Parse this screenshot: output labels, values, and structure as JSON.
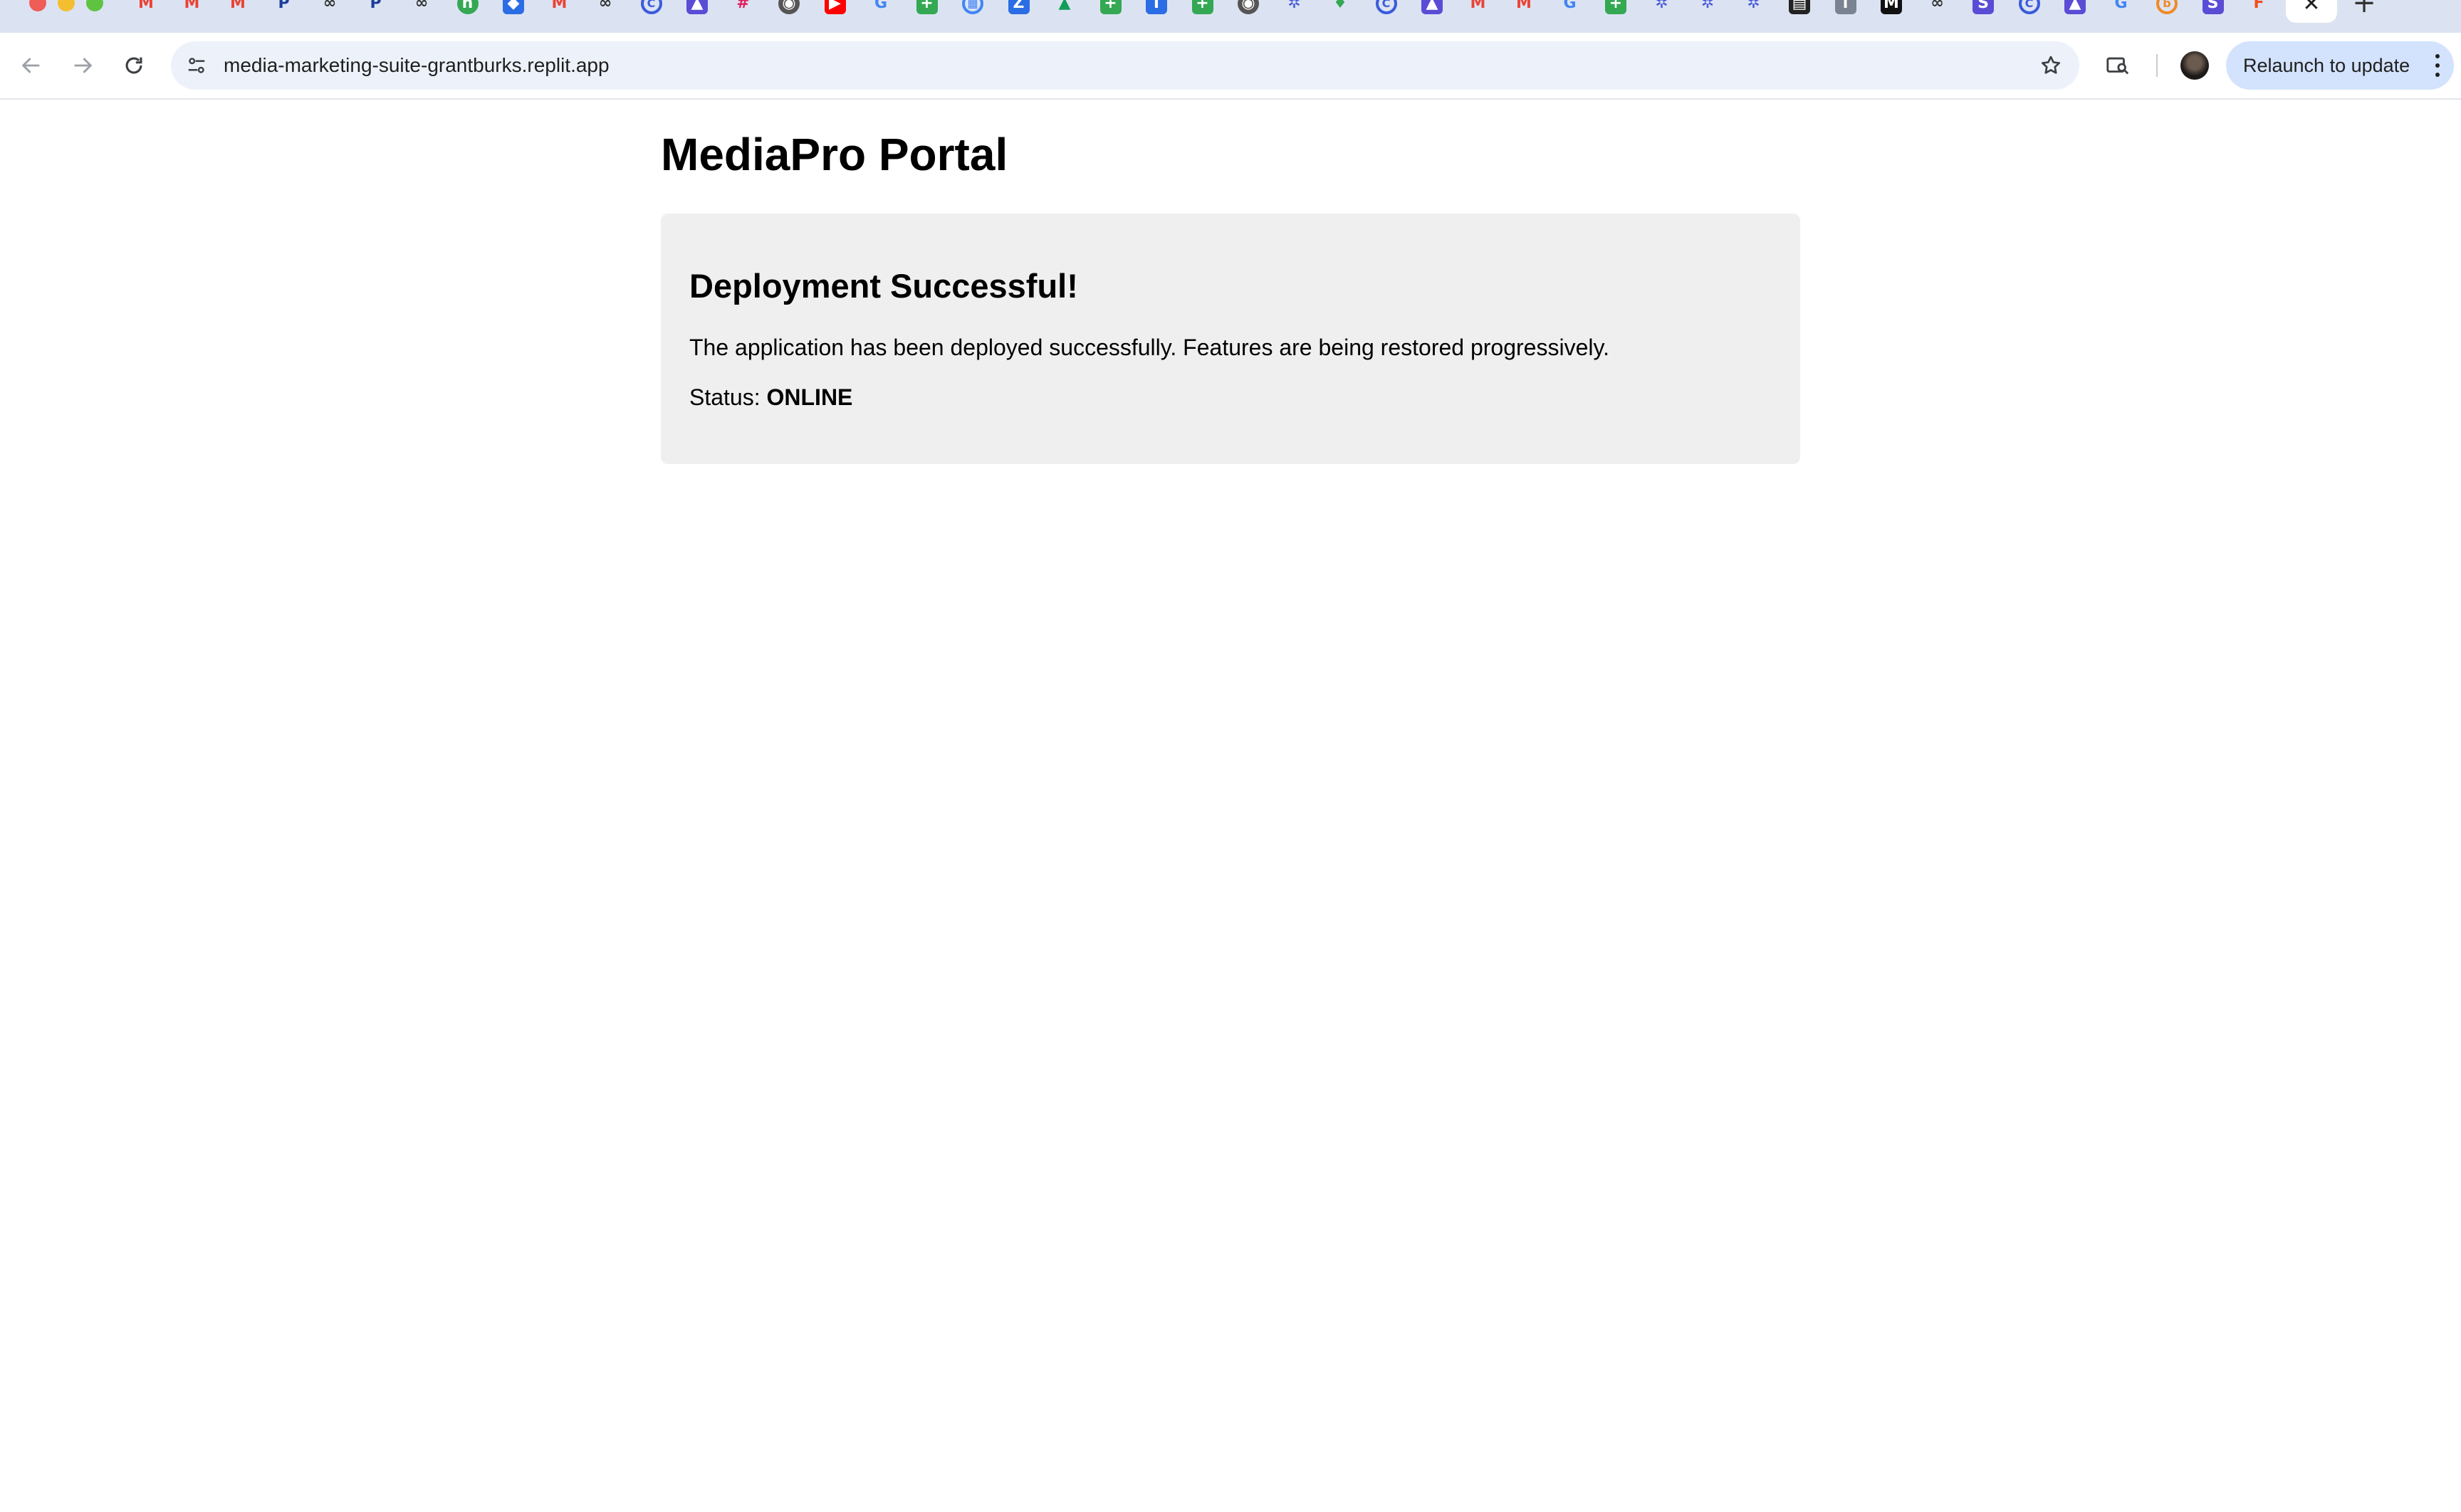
{
  "browser": {
    "url": "media-marketing-suite-grantburks.replit.app",
    "relaunch_label": "Relaunch to update",
    "tabs": [
      {
        "icon": "gmail-icon",
        "glyph": "M",
        "color": "#ea4335",
        "style": "plain"
      },
      {
        "icon": "gmail-icon",
        "glyph": "M",
        "color": "#ea4335",
        "style": "plain"
      },
      {
        "icon": "gmail-icon",
        "glyph": "M",
        "color": "#ea4335",
        "style": "plain"
      },
      {
        "icon": "paypal-icon",
        "glyph": "P",
        "color": "#1a3e9a",
        "style": "plain"
      },
      {
        "icon": "link-icon",
        "glyph": "∞",
        "color": "#333333",
        "style": "plain"
      },
      {
        "icon": "paypal-icon",
        "glyph": "P",
        "color": "#1a3e9a",
        "style": "plain"
      },
      {
        "icon": "link-icon",
        "glyph": "∞",
        "color": "#333333",
        "style": "plain"
      },
      {
        "icon": "green-app-icon",
        "glyph": "h",
        "color": "#34a853",
        "style": "circle"
      },
      {
        "icon": "dropbox-icon",
        "glyph": "◆",
        "color": "#2b6de4",
        "style": "square"
      },
      {
        "icon": "gmail-icon",
        "glyph": "M",
        "color": "#ea4335",
        "style": "plain"
      },
      {
        "icon": "link-icon",
        "glyph": "∞",
        "color": "#333333",
        "style": "plain"
      },
      {
        "icon": "blue-circle-icon",
        "glyph": "C",
        "color": "#3b5bdb",
        "style": "outline"
      },
      {
        "icon": "photo-icon",
        "glyph": "▲",
        "color": "#5b4cd6",
        "style": "square"
      },
      {
        "icon": "slack-icon",
        "glyph": "#",
        "color": "#e01e5a",
        "style": "plain"
      },
      {
        "icon": "globe-icon",
        "glyph": "◉",
        "color": "#555555",
        "style": "circle"
      },
      {
        "icon": "youtube-icon",
        "glyph": "▶",
        "color": "#ff0000",
        "style": "square"
      },
      {
        "icon": "google-icon",
        "glyph": "G",
        "color": "#4285f4",
        "style": "plain"
      },
      {
        "icon": "sheets-icon",
        "glyph": "+",
        "color": "#34a853",
        "style": "square"
      },
      {
        "icon": "calendar-icon",
        "glyph": "▦",
        "color": "#4285f4",
        "style": "outline"
      },
      {
        "icon": "blue-doc-icon",
        "glyph": "Z",
        "color": "#2b6de4",
        "style": "square"
      },
      {
        "icon": "drive-icon",
        "glyph": "▲",
        "color": "#0f9d58",
        "style": "plain"
      },
      {
        "icon": "sheets-icon",
        "glyph": "+",
        "color": "#34a853",
        "style": "square"
      },
      {
        "icon": "blue-doc-icon",
        "glyph": "I",
        "color": "#2b6de4",
        "style": "square"
      },
      {
        "icon": "sheets-icon",
        "glyph": "+",
        "color": "#34a853",
        "style": "square"
      },
      {
        "icon": "globe-icon",
        "glyph": "◉",
        "color": "#555555",
        "style": "circle"
      },
      {
        "icon": "gear-icon",
        "glyph": "✲",
        "color": "#4a5bd8",
        "style": "plain"
      },
      {
        "icon": "maps-icon",
        "glyph": "♦",
        "color": "#34a853",
        "style": "plain"
      },
      {
        "icon": "blue-circle-icon",
        "glyph": "C",
        "color": "#3b5bdb",
        "style": "outline"
      },
      {
        "icon": "photo-icon",
        "glyph": "▲",
        "color": "#5b4cd6",
        "style": "square"
      },
      {
        "icon": "gmail-icon",
        "glyph": "M",
        "color": "#ea4335",
        "style": "plain"
      },
      {
        "icon": "gmail-icon",
        "glyph": "M",
        "color": "#ea4335",
        "style": "plain"
      },
      {
        "icon": "google-icon",
        "glyph": "G",
        "color": "#4285f4",
        "style": "plain"
      },
      {
        "icon": "sheets-icon",
        "glyph": "+",
        "color": "#34a853",
        "style": "square"
      },
      {
        "icon": "gear-icon",
        "glyph": "✲",
        "color": "#4a5bd8",
        "style": "plain"
      },
      {
        "icon": "gear-icon",
        "glyph": "✲",
        "color": "#4a5bd8",
        "style": "plain"
      },
      {
        "icon": "gear-icon",
        "glyph": "✲",
        "color": "#4a5bd8",
        "style": "plain"
      },
      {
        "icon": "dark-app-icon",
        "glyph": "▤",
        "color": "#222222",
        "style": "square"
      },
      {
        "icon": "grey-doc-icon",
        "glyph": "i",
        "color": "#7a8391",
        "style": "square"
      },
      {
        "icon": "medium-icon",
        "glyph": "M",
        "color": "#111111",
        "style": "square"
      },
      {
        "icon": "link-icon",
        "glyph": "∞",
        "color": "#333333",
        "style": "plain"
      },
      {
        "icon": "purple-app-icon",
        "glyph": "S",
        "color": "#5b4cd6",
        "style": "square"
      },
      {
        "icon": "blue-circle-icon",
        "glyph": "C",
        "color": "#3b5bdb",
        "style": "outline"
      },
      {
        "icon": "photo-icon",
        "glyph": "▲",
        "color": "#5b4cd6",
        "style": "square"
      },
      {
        "icon": "google-icon",
        "glyph": "G",
        "color": "#4285f4",
        "style": "plain"
      },
      {
        "icon": "orange-circle-icon",
        "glyph": "b",
        "color": "#f08a24",
        "style": "outline"
      },
      {
        "icon": "purple-app-icon",
        "glyph": "S",
        "color": "#5b4cd6",
        "style": "square"
      },
      {
        "icon": "figma-icon",
        "glyph": "F",
        "color": "#f24e1e",
        "style": "plain"
      }
    ]
  },
  "page": {
    "title": "MediaPro Portal",
    "card": {
      "heading": "Deployment Successful!",
      "message": "The application has been deployed successfully. Features are being restored progressively.",
      "status_label": "Status: ",
      "status_value": "ONLINE"
    }
  },
  "colors": {
    "card_background": "#efefef",
    "tab_strip": "#dbe3f2",
    "omnibox": "#edf2fa",
    "relaunch_button": "#d3e3fd"
  }
}
